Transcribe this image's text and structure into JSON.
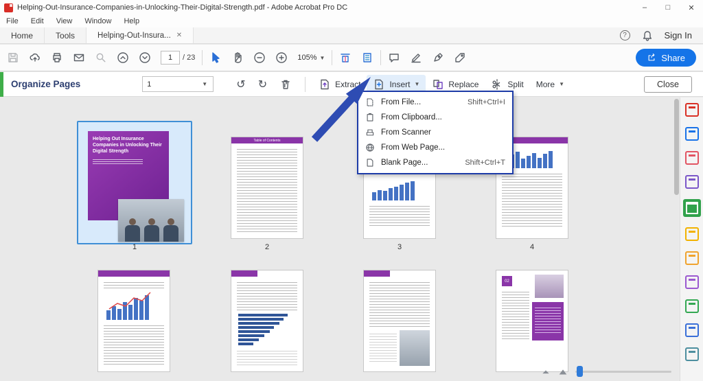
{
  "window": {
    "title": "Helping-Out-Insurance-Companies-in-Unlocking-Their-Digital-Strength.pdf - Adobe Acrobat Pro DC",
    "minimize": "–",
    "maximize": "□",
    "close": "✕"
  },
  "menubar": {
    "items": [
      "File",
      "Edit",
      "View",
      "Window",
      "Help"
    ]
  },
  "tabbar": {
    "home": "Home",
    "tools": "Tools",
    "document": "Helping-Out-Insura...",
    "close_tab": "✕",
    "help": "?",
    "sign_in": "Sign In"
  },
  "toolbar": {
    "page_current": "1",
    "page_total": "/ 23",
    "zoom_level": "105%",
    "share_label": "Share"
  },
  "organize_bar": {
    "title": "Organize Pages",
    "page_range": "1",
    "rotate_left": "↺",
    "rotate_right": "↻",
    "extract_label": "Extract",
    "insert_label": "Insert",
    "replace_label": "Replace",
    "split_label": "Split",
    "more_label": "More",
    "close_label": "Close"
  },
  "insert_menu": {
    "items": [
      {
        "label": "From File...",
        "shortcut": "Shift+Ctrl+I"
      },
      {
        "label": "From Clipboard...",
        "shortcut": ""
      },
      {
        "label": "From Scanner",
        "shortcut": ""
      },
      {
        "label": "From Web Page...",
        "shortcut": ""
      },
      {
        "label": "Blank Page...",
        "shortcut": "Shift+Ctrl+T"
      }
    ]
  },
  "thumbnails": {
    "cover_title": "Helping Out Insurance Companies in Unlocking Their Digital Strength",
    "toc_title": "Table of Contents",
    "page8_number": "02",
    "labels": [
      "1",
      "2",
      "3",
      "4"
    ]
  }
}
